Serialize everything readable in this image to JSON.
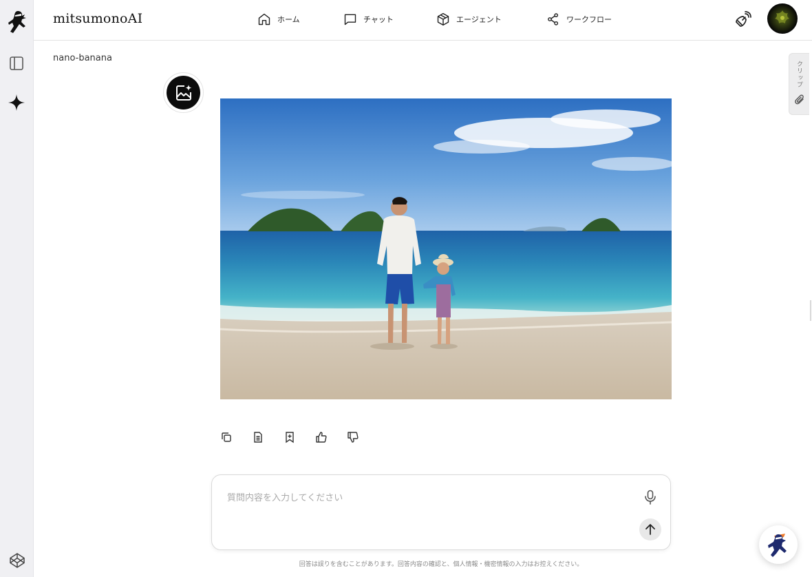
{
  "header": {
    "brand": "mitsumonoAI",
    "nav": [
      {
        "label": "ホーム",
        "icon": "home-icon"
      },
      {
        "label": "チャット",
        "icon": "chat-icon"
      },
      {
        "label": "エージェント",
        "icon": "cube-icon"
      },
      {
        "label": "ワークフロー",
        "icon": "share-icon"
      }
    ]
  },
  "chat": {
    "model_name": "nano-banana",
    "image_alt": "beach photo: father and daughter holding hands on a sandy beach with islands in the sea"
  },
  "composer": {
    "placeholder": "質問内容を入力してください"
  },
  "disclaimer": "回答は誤りを含むことがあります。回答内容の確認と、個人情報・機密情報の入力はお控えください。",
  "clip_tab": {
    "label": "クリップ"
  },
  "colors": {
    "sidebar_bg": "#f0f0f3",
    "brand_navy": "#1e2a6e",
    "accent_orange": "#f07a2a"
  }
}
